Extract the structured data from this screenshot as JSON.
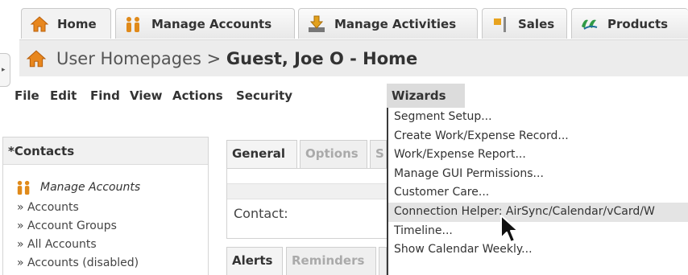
{
  "tabs": [
    {
      "label": "Home",
      "icon": "home-icon"
    },
    {
      "label": "Manage Accounts",
      "icon": "people-icon"
    },
    {
      "label": "Manage Activities",
      "icon": "download-icon"
    },
    {
      "label": "Sales",
      "icon": "flag-icon"
    },
    {
      "label": "Products",
      "icon": "products-icon"
    }
  ],
  "breadcrumb": {
    "prefix": "User Homepages > ",
    "current": "Guest, Joe O - Home"
  },
  "menubar": {
    "items": [
      "File",
      "Edit",
      "Find",
      "View",
      "Actions",
      "Security",
      "Wizards"
    ],
    "open": "Wizards"
  },
  "wizards_menu": [
    "Segment Setup...",
    "Create Work/Expense Record...",
    "Work/Expense Report...",
    "Manage GUI Permissions...",
    "Customer Care...",
    "Connection Helper: AirSync/Calendar/vCard/W",
    "Timeline...",
    "Show Calendar Weekly..."
  ],
  "highlighted_menu_item": "Connection Helper: AirSync/Calendar/vCard/W",
  "contacts": {
    "title": "*Contacts",
    "group": "Manage Accounts",
    "links": [
      "» Accounts",
      "» Account Groups",
      "» All Accounts",
      "» Accounts (disabled)"
    ]
  },
  "detail_tabs": [
    "General",
    "Options",
    "S"
  ],
  "contact_label": "Contact:",
  "bottom_tabs": [
    "Alerts",
    "Reminders",
    ""
  ],
  "colors": {
    "home_orange": "#e8871e",
    "accounts_orange": "#e08a1a",
    "activities_orange": "#e2a11c",
    "products_green": "#2f9a45",
    "menu_highlight": "#e4e4e4"
  }
}
